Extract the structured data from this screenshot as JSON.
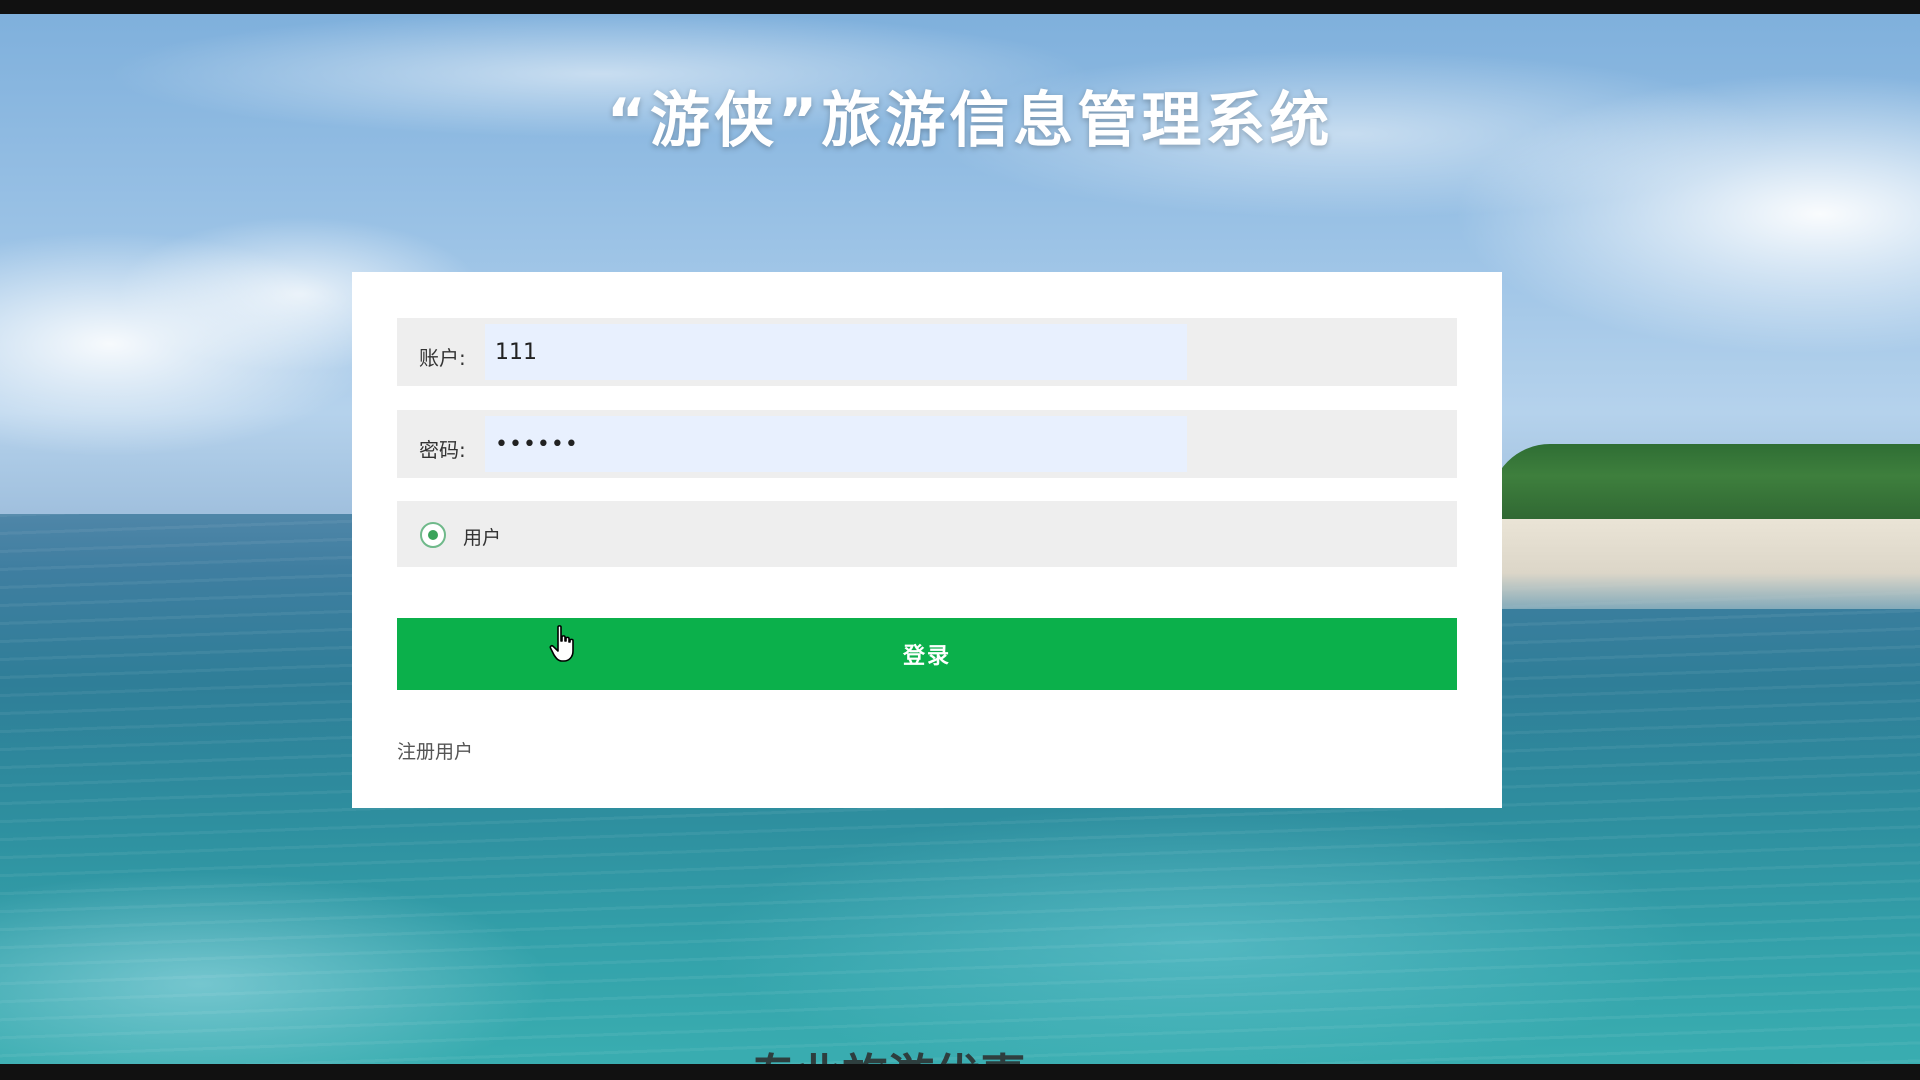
{
  "page": {
    "title": "“游侠”旅游信息管理系统"
  },
  "login_form": {
    "account_label": "账户:",
    "account_value": "111",
    "password_label": "密码:",
    "password_value": "••••••",
    "role_option_label": "用户",
    "role_selected": true,
    "login_button_label": "登录",
    "register_link_label": "注册用户"
  },
  "overlay": {
    "caption_text": "专业旅游优惠"
  },
  "colors": {
    "login_button": "#0bb04b",
    "input_background": "#e8f0fe",
    "row_background": "#eeeeee",
    "radio_accent": "#3aa35a"
  },
  "icons": {
    "cursor": "hand-pointer-icon",
    "radio": "radio-selected-icon"
  }
}
